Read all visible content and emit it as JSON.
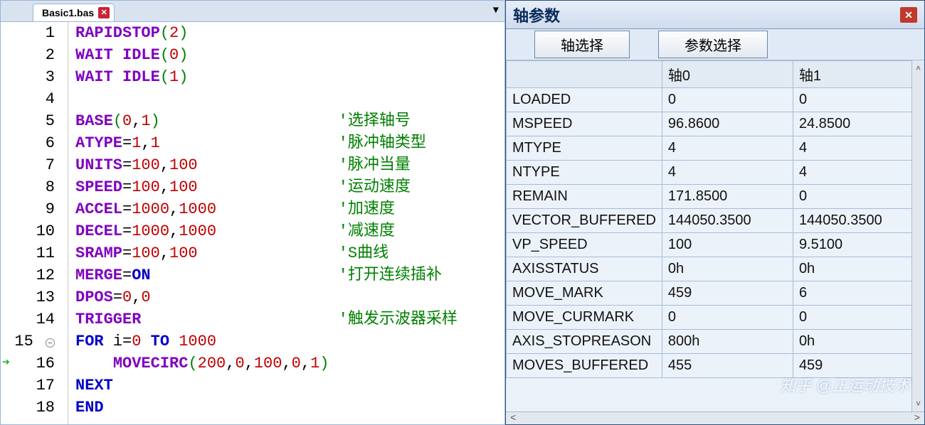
{
  "editor": {
    "tab_title": "Basic1.bas",
    "lines": [
      {
        "n": 1,
        "indent": 0,
        "tokens": [
          {
            "cls": "kw",
            "t": "RAPIDSTOP"
          },
          {
            "cls": "par",
            "t": "("
          },
          {
            "cls": "num",
            "t": "2"
          },
          {
            "cls": "par",
            "t": ")"
          }
        ]
      },
      {
        "n": 2,
        "indent": 0,
        "tokens": [
          {
            "cls": "kw",
            "t": "WAIT IDLE"
          },
          {
            "cls": "par",
            "t": "("
          },
          {
            "cls": "num",
            "t": "0"
          },
          {
            "cls": "par",
            "t": ")"
          }
        ]
      },
      {
        "n": 3,
        "indent": 0,
        "tokens": [
          {
            "cls": "kw",
            "t": "WAIT IDLE"
          },
          {
            "cls": "par",
            "t": "("
          },
          {
            "cls": "num",
            "t": "1"
          },
          {
            "cls": "par",
            "t": ")"
          }
        ]
      },
      {
        "n": 4,
        "indent": 0,
        "tokens": []
      },
      {
        "n": 5,
        "indent": 0,
        "tokens": [
          {
            "cls": "kw",
            "t": "BASE"
          },
          {
            "cls": "par",
            "t": "("
          },
          {
            "cls": "num",
            "t": "0"
          },
          {
            "cls": "var",
            "t": ","
          },
          {
            "cls": "num",
            "t": "1"
          },
          {
            "cls": "par",
            "t": ")"
          }
        ],
        "comment": "选择轴号"
      },
      {
        "n": 6,
        "indent": 0,
        "tokens": [
          {
            "cls": "kw",
            "t": "ATYPE"
          },
          {
            "cls": "var",
            "t": "="
          },
          {
            "cls": "num",
            "t": "1"
          },
          {
            "cls": "var",
            "t": ","
          },
          {
            "cls": "num",
            "t": "1"
          }
        ],
        "comment": "脉冲轴类型"
      },
      {
        "n": 7,
        "indent": 0,
        "tokens": [
          {
            "cls": "kw",
            "t": "UNITS"
          },
          {
            "cls": "var",
            "t": "="
          },
          {
            "cls": "num",
            "t": "100"
          },
          {
            "cls": "var",
            "t": ","
          },
          {
            "cls": "num",
            "t": "100"
          }
        ],
        "comment": "脉冲当量"
      },
      {
        "n": 8,
        "indent": 0,
        "tokens": [
          {
            "cls": "kw",
            "t": "SPEED"
          },
          {
            "cls": "var",
            "t": "="
          },
          {
            "cls": "num",
            "t": "100"
          },
          {
            "cls": "var",
            "t": ","
          },
          {
            "cls": "num",
            "t": "100"
          }
        ],
        "comment": "运动速度"
      },
      {
        "n": 9,
        "indent": 0,
        "tokens": [
          {
            "cls": "kw",
            "t": "ACCEL"
          },
          {
            "cls": "var",
            "t": "="
          },
          {
            "cls": "num",
            "t": "1000"
          },
          {
            "cls": "var",
            "t": ","
          },
          {
            "cls": "num",
            "t": "1000"
          }
        ],
        "comment": "加速度"
      },
      {
        "n": 10,
        "indent": 0,
        "tokens": [
          {
            "cls": "kw",
            "t": "DECEL"
          },
          {
            "cls": "var",
            "t": "="
          },
          {
            "cls": "num",
            "t": "1000"
          },
          {
            "cls": "var",
            "t": ","
          },
          {
            "cls": "num",
            "t": "1000"
          }
        ],
        "comment": "减速度"
      },
      {
        "n": 11,
        "indent": 0,
        "tokens": [
          {
            "cls": "kw",
            "t": "SRAMP"
          },
          {
            "cls": "var",
            "t": "="
          },
          {
            "cls": "num",
            "t": "100"
          },
          {
            "cls": "var",
            "t": ","
          },
          {
            "cls": "num",
            "t": "100"
          }
        ],
        "comment": "S曲线"
      },
      {
        "n": 12,
        "indent": 0,
        "tokens": [
          {
            "cls": "kw",
            "t": "MERGE"
          },
          {
            "cls": "var",
            "t": "="
          },
          {
            "cls": "kw2",
            "t": "ON"
          }
        ],
        "comment": "打开连续插补"
      },
      {
        "n": 13,
        "indent": 0,
        "tokens": [
          {
            "cls": "kw",
            "t": "DPOS"
          },
          {
            "cls": "var",
            "t": "="
          },
          {
            "cls": "num",
            "t": "0"
          },
          {
            "cls": "var",
            "t": ","
          },
          {
            "cls": "num",
            "t": "0"
          }
        ]
      },
      {
        "n": 14,
        "indent": 0,
        "tokens": [
          {
            "cls": "kw",
            "t": "TRIGGER"
          }
        ],
        "comment": "触发示波器采样"
      },
      {
        "n": 15,
        "indent": 0,
        "fold": true,
        "tokens": [
          {
            "cls": "kw2",
            "t": "FOR"
          },
          {
            "cls": "var",
            "t": " i"
          },
          {
            "cls": "var",
            "t": "="
          },
          {
            "cls": "num",
            "t": "0"
          },
          {
            "cls": "var",
            "t": " "
          },
          {
            "cls": "kw2",
            "t": "TO"
          },
          {
            "cls": "var",
            "t": " "
          },
          {
            "cls": "num",
            "t": "1000"
          }
        ]
      },
      {
        "n": 16,
        "indent": 1,
        "exec": true,
        "tokens": [
          {
            "cls": "kw",
            "t": "MOVECIRC"
          },
          {
            "cls": "par",
            "t": "("
          },
          {
            "cls": "num",
            "t": "200"
          },
          {
            "cls": "var",
            "t": ","
          },
          {
            "cls": "num",
            "t": "0"
          },
          {
            "cls": "var",
            "t": ","
          },
          {
            "cls": "num",
            "t": "100"
          },
          {
            "cls": "var",
            "t": ","
          },
          {
            "cls": "num",
            "t": "0"
          },
          {
            "cls": "var",
            "t": ","
          },
          {
            "cls": "num",
            "t": "1"
          },
          {
            "cls": "par",
            "t": ")"
          }
        ]
      },
      {
        "n": 17,
        "indent": 0,
        "tokens": [
          {
            "cls": "kw2",
            "t": "NEXT"
          }
        ]
      },
      {
        "n": 18,
        "indent": 0,
        "tokens": [
          {
            "cls": "kw2",
            "t": "END"
          }
        ]
      }
    ]
  },
  "panel": {
    "title": "轴参数",
    "btn_axis": "轴选择",
    "btn_param": "参数选择",
    "headers": [
      "",
      "轴0",
      "轴1"
    ],
    "rows": [
      {
        "name": "LOADED",
        "v0": "0",
        "v1": "0"
      },
      {
        "name": "MSPEED",
        "v0": "96.8600",
        "v1": "24.8500"
      },
      {
        "name": "MTYPE",
        "v0": "4",
        "v1": "4"
      },
      {
        "name": "NTYPE",
        "v0": "4",
        "v1": "4"
      },
      {
        "name": "REMAIN",
        "v0": "171.8500",
        "v1": "0"
      },
      {
        "name": "VECTOR_BUFFERED",
        "v0": "144050.3500",
        "v1": "144050.3500"
      },
      {
        "name": "VP_SPEED",
        "v0": "100",
        "v1": "9.5100"
      },
      {
        "name": "AXISSTATUS",
        "v0": "0h",
        "v1": "0h"
      },
      {
        "name": "MOVE_MARK",
        "v0": "459",
        "v1": "6"
      },
      {
        "name": "MOVE_CURMARK",
        "v0": "0",
        "v1": "0"
      },
      {
        "name": "AXIS_STOPREASON",
        "v0": "800h",
        "v1": "0h"
      },
      {
        "name": "MOVES_BUFFERED",
        "v0": "455",
        "v1": "459"
      }
    ],
    "watermark": "知乎 @正运动技术"
  }
}
